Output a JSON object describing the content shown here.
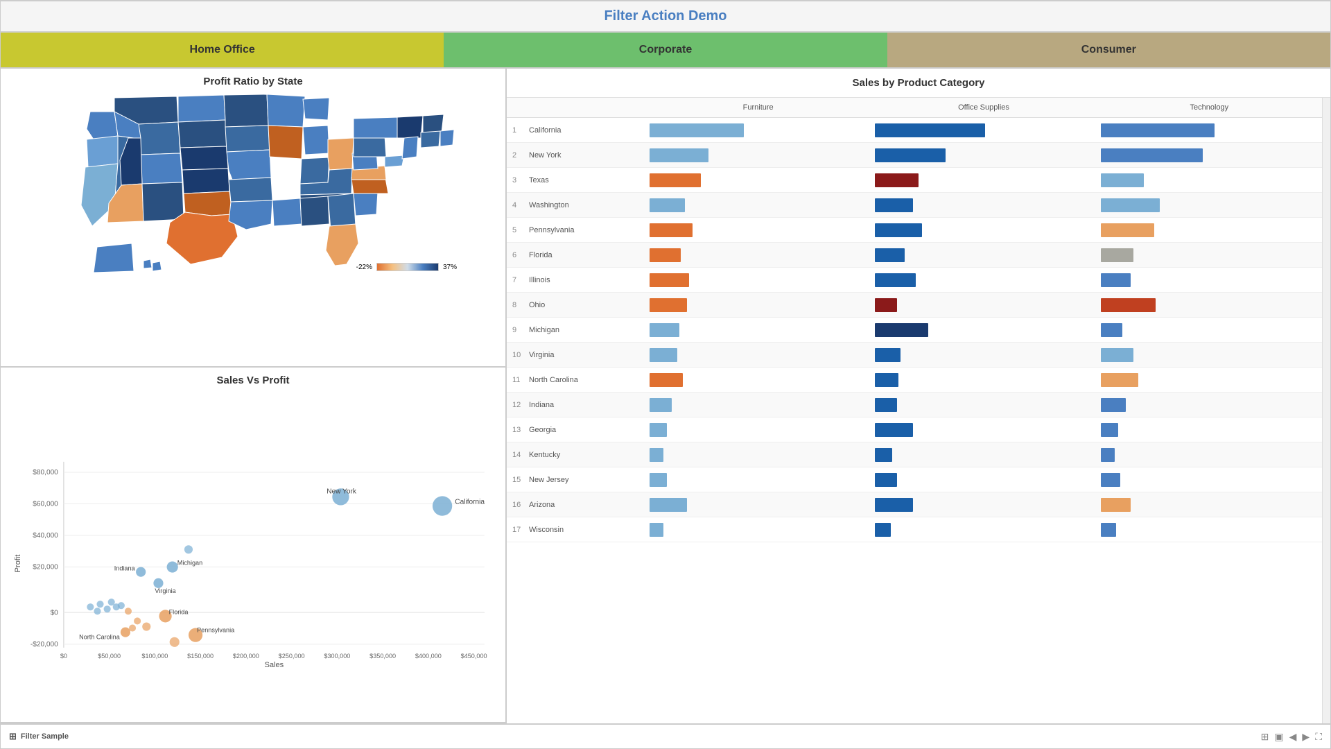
{
  "header": {
    "title": "Filter Action Demo"
  },
  "segments": [
    {
      "label": "Home Office",
      "class": "seg-home"
    },
    {
      "label": "Corporate",
      "class": "seg-corp"
    },
    {
      "label": "Consumer",
      "class": "seg-cons"
    }
  ],
  "profit_map": {
    "title": "Profit Ratio by State",
    "legend_min": "-22%",
    "legend_max": "37%"
  },
  "scatter": {
    "title": "Sales Vs Profit",
    "x_label": "Sales",
    "y_label": "Profit",
    "x_ticks": [
      "$0",
      "$50,000",
      "$100,000",
      "$150,000",
      "$200,000",
      "$250,000",
      "$300,000",
      "$350,000",
      "$400,000",
      "$450,000"
    ],
    "y_ticks": [
      "$80,000",
      "$60,000",
      "$40,000",
      "$20,000",
      "$0",
      "-$20,000"
    ],
    "points": [
      {
        "label": "California",
        "x": 430,
        "y": 75,
        "r": 14,
        "color": "#7bafd4"
      },
      {
        "label": "New York",
        "x": 320,
        "y": 85,
        "r": 12,
        "color": "#7bafd4"
      },
      {
        "label": "Michigan",
        "x": 185,
        "y": 178,
        "r": 8,
        "color": "#7bafd4"
      },
      {
        "label": "Indiana",
        "x": 155,
        "y": 185,
        "r": 7,
        "color": "#7bafd4"
      },
      {
        "label": "Virginia",
        "x": 185,
        "y": 200,
        "r": 7,
        "color": "#7bafd4"
      },
      {
        "label": "Florida",
        "x": 208,
        "y": 245,
        "r": 9,
        "color": "#e8a060"
      },
      {
        "label": "North Carolina",
        "x": 158,
        "y": 268,
        "r": 7,
        "color": "#e8a060"
      },
      {
        "label": "Pennsylvania",
        "x": 258,
        "y": 270,
        "r": 10,
        "color": "#e8a060"
      },
      {
        "label": "",
        "x": 170,
        "y": 255,
        "r": 6,
        "color": "#e8a060"
      },
      {
        "label": "",
        "x": 182,
        "y": 248,
        "r": 5,
        "color": "#e8a060"
      },
      {
        "label": "",
        "x": 145,
        "y": 238,
        "r": 5,
        "color": "#7bafd4"
      },
      {
        "label": "",
        "x": 130,
        "y": 235,
        "r": 5,
        "color": "#7bafd4"
      },
      {
        "label": "",
        "x": 120,
        "y": 232,
        "r": 5,
        "color": "#7bafd4"
      },
      {
        "label": "",
        "x": 135,
        "y": 228,
        "r": 5,
        "color": "#7bafd4"
      },
      {
        "label": "",
        "x": 155,
        "y": 225,
        "r": 5,
        "color": "#7bafd4"
      },
      {
        "label": "",
        "x": 160,
        "y": 230,
        "r": 5,
        "color": "#7bafd4"
      },
      {
        "label": "",
        "x": 148,
        "y": 242,
        "r": 5,
        "color": "#7bafd4"
      },
      {
        "label": "",
        "x": 190,
        "y": 242,
        "r": 5,
        "color": "#e8a060"
      },
      {
        "label": "",
        "x": 220,
        "y": 265,
        "r": 6,
        "color": "#e8a060"
      },
      {
        "label": "",
        "x": 240,
        "y": 285,
        "r": 7,
        "color": "#e8a060"
      },
      {
        "label": "",
        "x": 210,
        "y": 170,
        "r": 6,
        "color": "#7bafd4"
      },
      {
        "label": "",
        "x": 225,
        "y": 162,
        "r": 6,
        "color": "#7bafd4"
      },
      {
        "label": "",
        "x": 200,
        "y": 155,
        "r": 5,
        "color": "#7bafd4"
      },
      {
        "label": "",
        "x": 235,
        "y": 148,
        "r": 5,
        "color": "#7bafd4"
      }
    ]
  },
  "sales_table": {
    "title": "Sales by Product Category",
    "columns": [
      "Furniture",
      "Office Supplies",
      "Technology"
    ],
    "rows": [
      {
        "rank": 1,
        "state": "California",
        "furniture": 120,
        "office": 140,
        "tech": 145
      },
      {
        "rank": 2,
        "state": "New York",
        "furniture": 75,
        "office": 90,
        "tech": 130
      },
      {
        "rank": 3,
        "state": "Texas",
        "furniture": 65,
        "office": 55,
        "tech": 55
      },
      {
        "rank": 4,
        "state": "Washington",
        "furniture": 45,
        "office": 48,
        "tech": 75
      },
      {
        "rank": 5,
        "state": "Pennsylvania",
        "furniture": 55,
        "office": 60,
        "tech": 68
      },
      {
        "rank": 6,
        "state": "Florida",
        "furniture": 40,
        "office": 38,
        "tech": 42
      },
      {
        "rank": 7,
        "state": "Illinois",
        "furniture": 50,
        "office": 52,
        "tech": 38
      },
      {
        "rank": 8,
        "state": "Ohio",
        "furniture": 48,
        "office": 28,
        "tech": 70
      },
      {
        "rank": 9,
        "state": "Michigan",
        "furniture": 38,
        "office": 68,
        "tech": 28
      },
      {
        "rank": 10,
        "state": "Virginia",
        "furniture": 35,
        "office": 32,
        "tech": 42
      },
      {
        "rank": 11,
        "state": "North Carolina",
        "furniture": 42,
        "office": 30,
        "tech": 48
      },
      {
        "rank": 12,
        "state": "Indiana",
        "furniture": 28,
        "office": 28,
        "tech": 32
      },
      {
        "rank": 13,
        "state": "Georgia",
        "furniture": 22,
        "office": 48,
        "tech": 22
      },
      {
        "rank": 14,
        "state": "Kentucky",
        "furniture": 18,
        "office": 22,
        "tech": 18
      },
      {
        "rank": 15,
        "state": "New Jersey",
        "furniture": 22,
        "office": 28,
        "tech": 25
      },
      {
        "rank": 16,
        "state": "Arizona",
        "furniture": 48,
        "office": 48,
        "tech": 38
      },
      {
        "rank": 17,
        "state": "Wisconsin",
        "furniture": 18,
        "office": 20,
        "tech": 20
      }
    ],
    "bar_colors": {
      "furniture_pos": "#7bafd4",
      "furniture_neg": "#e07030",
      "office_pos": "#1a5fa8",
      "office_neg": "#8b1a1a",
      "tech_pos": "#4a7fc1",
      "tech_neg": "#c04020",
      "tech_gray": "#a8a8a0"
    },
    "max_val": 150
  },
  "footer": {
    "label": "Filter Sample",
    "icon": "⊞"
  }
}
